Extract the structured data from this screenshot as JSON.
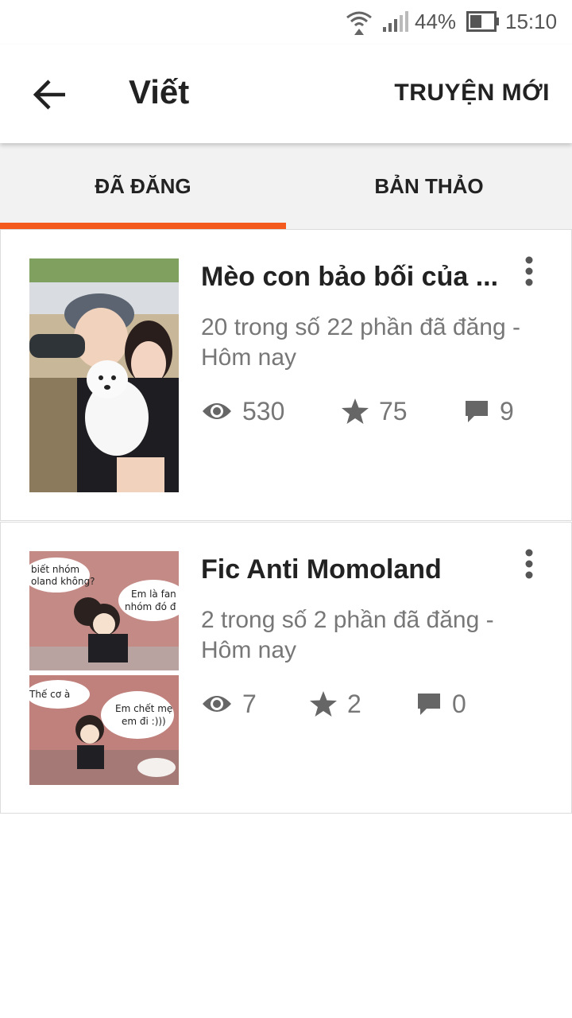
{
  "status_bar": {
    "battery_percent": "44%",
    "time": "15:10",
    "icons": [
      "wifi-icon",
      "signal-icon",
      "battery-icon"
    ]
  },
  "app_bar": {
    "title": "Viết",
    "action_label": "TRUYỆN MỚI",
    "back_icon": "arrow-left-icon"
  },
  "tabs": [
    {
      "label": "ĐÃ ĐĂNG",
      "active": true
    },
    {
      "label": "BẢN THẢO",
      "active": false
    }
  ],
  "colors": {
    "accent": "#f45a1d",
    "text_primary": "#222222",
    "text_secondary": "#777777",
    "tab_background": "#f2f2f2"
  },
  "stories": [
    {
      "title": "Mèo con bảo bối của ...",
      "parts_line1": "20 trong số 22 phần đã đăng -",
      "parts_line2": "Hôm nay",
      "views": "530",
      "votes": "75",
      "comments": "9"
    },
    {
      "title": "Fic Anti Momoland",
      "parts_line1": "2 trong số 2 phần đã đăng -",
      "parts_line2": "Hôm nay",
      "views": "7",
      "votes": "2",
      "comments": "0",
      "cover_texts": [
        "biết nhóm",
        "oland không?",
        "Em là fan",
        "nhóm đó đ",
        "Thế cơ à",
        "Em chết mẹ",
        "em đi :)))"
      ]
    }
  ]
}
